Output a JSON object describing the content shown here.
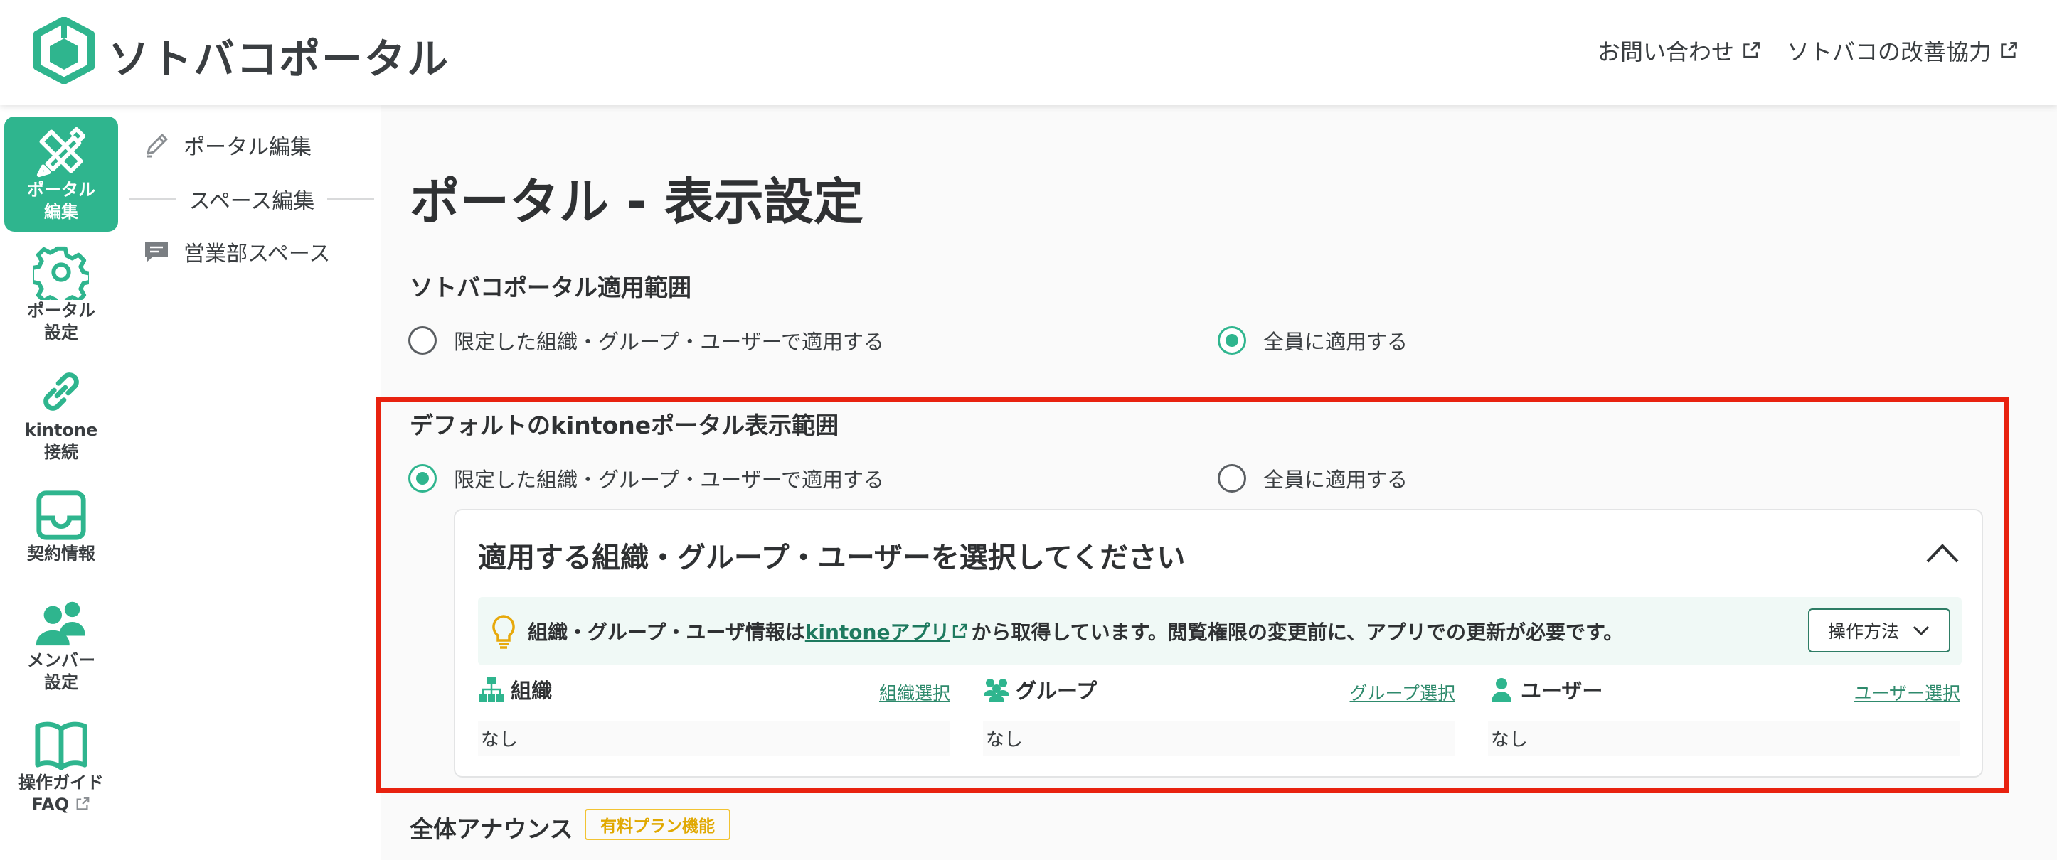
{
  "header": {
    "app_name": "ソトバコポータル",
    "links": [
      {
        "label": "お問い合わせ"
      },
      {
        "label": "ソトバコの改善協力"
      }
    ]
  },
  "rail": {
    "items": [
      {
        "label_line1": "ポータル",
        "label_line2": "編集",
        "icon": "pencil-ruler-icon",
        "active": true
      },
      {
        "label_line1": "ポータル",
        "label_line2": "設定",
        "icon": "gear-icon",
        "active": false
      },
      {
        "label_line1": "kintone",
        "label_line2": "接続",
        "icon": "link-icon",
        "active": false
      },
      {
        "label_line1": "契約情報",
        "label_line2": "",
        "icon": "inbox-tray-icon",
        "active": false
      },
      {
        "label_line1": "メンバー",
        "label_line2": "設定",
        "icon": "members-icon",
        "active": false
      },
      {
        "label_line1": "操作ガイド",
        "label_line2": "FAQ",
        "icon": "book-icon",
        "active": false
      }
    ]
  },
  "subnav": {
    "portal_edit": "ポータル編集",
    "space_edit_divider": "スペース編集",
    "sales_space": "営業部スペース"
  },
  "main": {
    "page_title": "ポータル - 表示設定",
    "scope_section": {
      "title": "ソトバコポータル適用範囲",
      "option_limited": "限定した組織・グループ・ユーザーで適用する",
      "option_all": "全員に適用する",
      "selected": "all"
    },
    "default_section": {
      "title": "デフォルトのkintoneポータル表示範囲",
      "option_limited": "限定した組織・グループ・ユーザーで適用する",
      "option_all": "全員に適用する",
      "selected": "limited"
    },
    "panel": {
      "title": "適用する組織・グループ・ユーザーを選択してください",
      "info_prefix": "組織・グループ・ユーザ情報は",
      "info_link": "kintoneアプリ",
      "info_suffix": "から取得しています。閲覧権限の変更前に、アプリでの更新が必要です。",
      "howto_button": "操作方法",
      "columns": [
        {
          "name": "組織",
          "link": "組織選択",
          "value": "なし",
          "icon": "org-chart-icon"
        },
        {
          "name": "グループ",
          "link": "グループ選択",
          "value": "なし",
          "icon": "group-icon"
        },
        {
          "name": "ユーザー",
          "link": "ユーザー選択",
          "value": "なし",
          "icon": "user-icon"
        }
      ]
    },
    "announce": {
      "title": "全体アナウンス",
      "badge": "有料プラン機能"
    }
  },
  "colors": {
    "accent": "#2fb58e",
    "highlight_border": "#e8220f",
    "badge": "#f2c332"
  }
}
